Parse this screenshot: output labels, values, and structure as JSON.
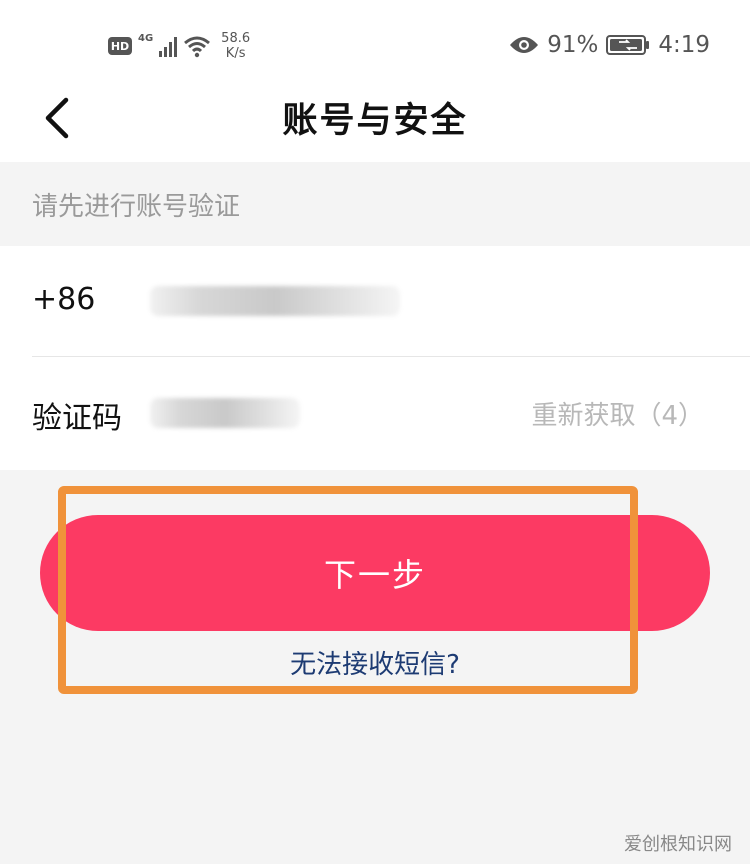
{
  "status_bar": {
    "hd_label": "HD",
    "network_type": "4G",
    "speed_value": "58.6",
    "speed_unit": "K/s",
    "battery_percent": "91%",
    "time": "4:19",
    "icons": [
      "signal-icon",
      "wifi-icon",
      "eye-icon",
      "battery-icon"
    ]
  },
  "header": {
    "title": "账号与安全",
    "back_icon": "chevron-left-icon"
  },
  "notice": {
    "text": "请先进行账号验证"
  },
  "form": {
    "phone_prefix": "+86",
    "code_label": "验证码",
    "resend_label": "重新获取（4）"
  },
  "actions": {
    "next_label": "下一步",
    "sms_help_label": "无法接收短信?"
  },
  "colors": {
    "primary": "#fc3a63",
    "link": "#1d3b73",
    "highlight": "#f0923a"
  },
  "watermark": "爱创根知识网"
}
